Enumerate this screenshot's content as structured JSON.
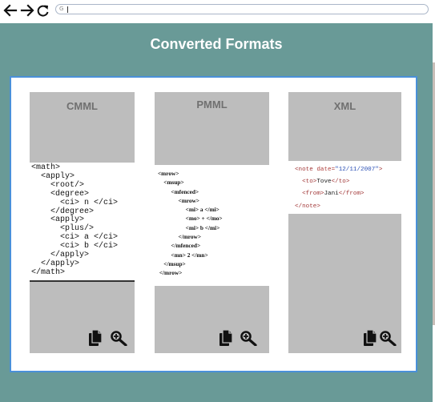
{
  "browser": {
    "address_icon": "G",
    "address_value": ""
  },
  "page": {
    "title": "Converted Formats"
  },
  "columns": [
    {
      "id": "cmml",
      "title": "CMML",
      "code": "<math>\n  <apply>\n    <root/>\n    <degree>\n      <ci> n </ci>\n    </degree>\n    <apply>\n      <plus/>\n      <ci> a </ci>\n      <ci> b </ci>\n    </apply>\n  </apply>\n</math>"
    },
    {
      "id": "pmml",
      "title": "PMML",
      "code": "<mrow>\n    <msup>\n         <mfenced>\n              <mrow>\n                   <mi> a </mi>\n                   <mo> + </mo>\n                   <mi> b </mi>\n              </mrow>\n         </mfenced>\n         <mn> 2 </mn>\n    </msup>\n </mrow>"
    },
    {
      "id": "xml",
      "title": "XML",
      "xml": {
        "open_tag": "<note",
        "attr_name": " date=",
        "attr_value": "\"12/11/2007\"",
        "open_end": ">",
        "to_open": "<to>",
        "to_text": "Tove",
        "to_close": "</to>",
        "from_open": "<from>",
        "from_text": "Jani",
        "from_close": "</from>",
        "close_tag": "</note>"
      }
    }
  ],
  "icons": {
    "copy": "copy-icon",
    "zoom": "zoom-search-icon",
    "back": "arrow-left-icon",
    "forward": "arrow-right-icon",
    "reload": "reload-icon"
  }
}
